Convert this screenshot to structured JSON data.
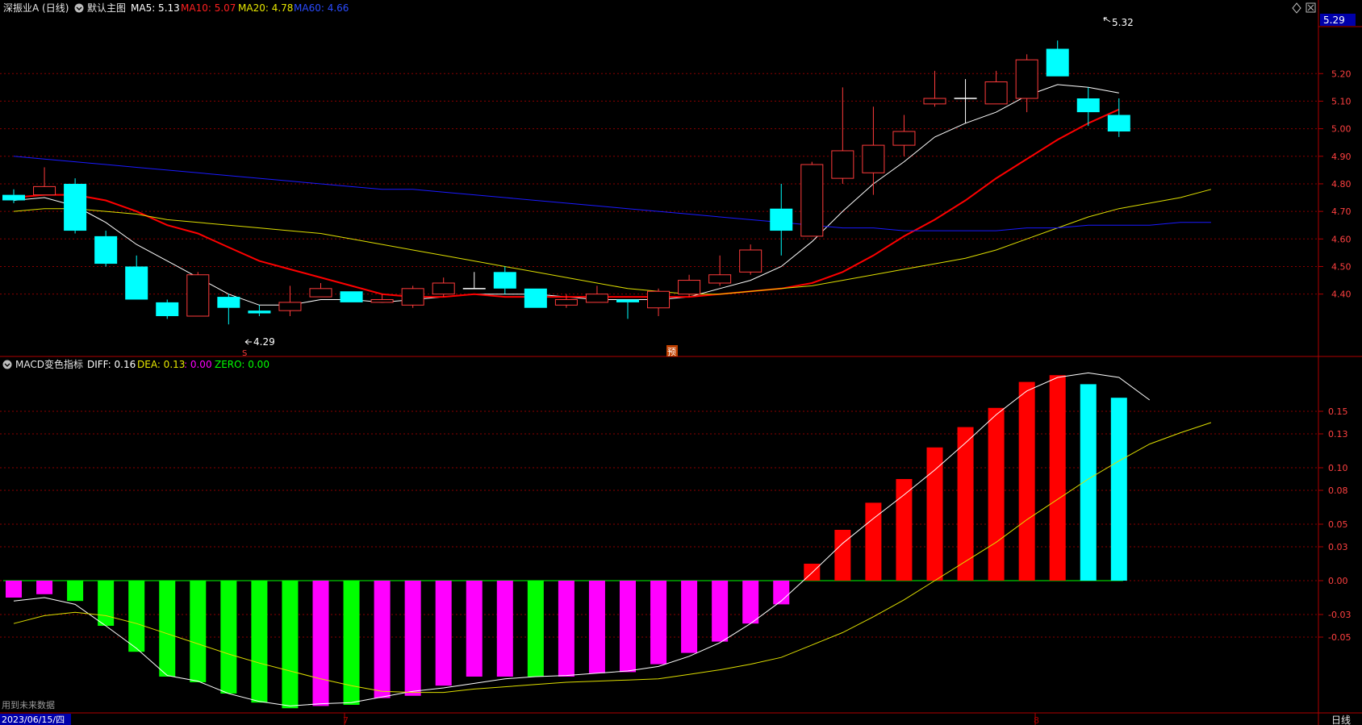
{
  "header": {
    "title": "深振业A (日线)",
    "main_label": "默认主图",
    "ma5_label": "MA5: 5.13",
    "ma10_label": "MA10: 5.07",
    "ma20_label": "MA20: 4.78",
    "ma60_label": "MA60: 4.66"
  },
  "macd_header": {
    "title": "MACD变色指标",
    "diff_label": "DIFF: 0.16",
    "dea_label": "DEA: 0.13",
    "macd_label": ": 0.00",
    "zero_label": "ZERO: 0.00"
  },
  "current_price": "5.29",
  "status_text": "用到未来数据",
  "bottom_bar": {
    "date_label": "2023/06/15/四",
    "period_label": "日线",
    "month_ticks": [
      "7",
      "8"
    ]
  },
  "markers": {
    "low": "4.29",
    "high": "5.32",
    "ex_right": "S",
    "forecast": "预"
  },
  "colors": {
    "up": "#ff3b3b",
    "down": "#00ffff",
    "ma5": "#ffffff",
    "ma10": "#ff0000",
    "ma20": "#dede00",
    "ma60": "#1a1aff",
    "grid": "#8b0000",
    "macd_pos": "#ff0000",
    "macd_pos_falling": "#00ffff",
    "macd_neg": "#ff00ff",
    "macd_neg_green": "#00ff00"
  },
  "chart_data": [
    {
      "type": "candlestick",
      "title": "深振业A (日线)",
      "ylim": [
        4.2,
        5.35
      ],
      "y_ticks": [
        4.4,
        4.5,
        4.6,
        4.7,
        4.8,
        4.9,
        5.0,
        5.1,
        5.2
      ],
      "candles": [
        {
          "o": 4.76,
          "h": 4.78,
          "l": 4.73,
          "c": 4.74
        },
        {
          "o": 4.76,
          "h": 4.86,
          "l": 4.76,
          "c": 4.79
        },
        {
          "o": 4.8,
          "h": 4.82,
          "l": 4.62,
          "c": 4.63
        },
        {
          "o": 4.61,
          "h": 4.63,
          "l": 4.5,
          "c": 4.51
        },
        {
          "o": 4.5,
          "h": 4.54,
          "l": 4.38,
          "c": 4.38
        },
        {
          "o": 4.37,
          "h": 4.38,
          "l": 4.31,
          "c": 4.32
        },
        {
          "o": 4.32,
          "h": 4.48,
          "l": 4.32,
          "c": 4.47
        },
        {
          "o": 4.39,
          "h": 4.4,
          "l": 4.29,
          "c": 4.35
        },
        {
          "o": 4.34,
          "h": 4.36,
          "l": 4.32,
          "c": 4.33
        },
        {
          "o": 4.34,
          "h": 4.43,
          "l": 4.32,
          "c": 4.37
        },
        {
          "o": 4.39,
          "h": 4.44,
          "l": 4.39,
          "c": 4.42
        },
        {
          "o": 4.41,
          "h": 4.41,
          "l": 4.37,
          "c": 4.37
        },
        {
          "o": 4.37,
          "h": 4.4,
          "l": 4.37,
          "c": 4.38
        },
        {
          "o": 4.36,
          "h": 4.43,
          "l": 4.35,
          "c": 4.42
        },
        {
          "o": 4.4,
          "h": 4.46,
          "l": 4.39,
          "c": 4.44
        },
        {
          "o": 4.42,
          "h": 4.48,
          "l": 4.42,
          "c": 4.42
        },
        {
          "o": 4.48,
          "h": 4.5,
          "l": 4.4,
          "c": 4.42
        },
        {
          "o": 4.42,
          "h": 4.42,
          "l": 4.35,
          "c": 4.35
        },
        {
          "o": 4.36,
          "h": 4.4,
          "l": 4.35,
          "c": 4.38
        },
        {
          "o": 4.37,
          "h": 4.43,
          "l": 4.37,
          "c": 4.4
        },
        {
          "o": 4.38,
          "h": 4.38,
          "l": 4.31,
          "c": 4.37
        },
        {
          "o": 4.35,
          "h": 4.42,
          "l": 4.32,
          "c": 4.41
        },
        {
          "o": 4.4,
          "h": 4.47,
          "l": 4.39,
          "c": 4.45
        },
        {
          "o": 4.44,
          "h": 4.54,
          "l": 4.43,
          "c": 4.47
        },
        {
          "o": 4.48,
          "h": 4.58,
          "l": 4.47,
          "c": 4.56
        },
        {
          "o": 4.71,
          "h": 4.8,
          "l": 4.54,
          "c": 4.63
        },
        {
          "o": 4.61,
          "h": 4.88,
          "l": 4.61,
          "c": 4.87
        },
        {
          "o": 4.82,
          "h": 5.15,
          "l": 4.8,
          "c": 4.92
        },
        {
          "o": 4.84,
          "h": 5.08,
          "l": 4.76,
          "c": 4.94
        },
        {
          "o": 4.94,
          "h": 5.05,
          "l": 4.9,
          "c": 4.99
        },
        {
          "o": 5.09,
          "h": 5.21,
          "l": 5.08,
          "c": 5.11
        },
        {
          "o": 5.11,
          "h": 5.18,
          "l": 5.02,
          "c": 5.11
        },
        {
          "o": 5.09,
          "h": 5.21,
          "l": 5.09,
          "c": 5.17
        },
        {
          "o": 5.11,
          "h": 5.27,
          "l": 5.06,
          "c": 5.25
        },
        {
          "o": 5.29,
          "h": 5.32,
          "l": 5.19,
          "c": 5.19
        },
        {
          "o": 5.11,
          "h": 5.15,
          "l": 5.01,
          "c": 5.06
        },
        {
          "o": 5.05,
          "h": 5.11,
          "l": 4.97,
          "c": 4.99
        }
      ],
      "series": [
        {
          "name": "MA5",
          "values": [
            4.74,
            4.75,
            4.72,
            4.66,
            4.58,
            4.52,
            4.46,
            4.4,
            4.36,
            4.36,
            4.38,
            4.38,
            4.37,
            4.38,
            4.39,
            4.4,
            4.4,
            4.4,
            4.39,
            4.38,
            4.38,
            4.38,
            4.39,
            4.42,
            4.45,
            4.5,
            4.59,
            4.7,
            4.8,
            4.88,
            4.97,
            5.02,
            5.06,
            5.12,
            5.16,
            5.15,
            5.13
          ]
        },
        {
          "name": "MA10",
          "values": [
            4.75,
            4.76,
            4.76,
            4.74,
            4.7,
            4.65,
            4.62,
            4.57,
            4.52,
            4.49,
            4.46,
            4.43,
            4.4,
            4.39,
            4.39,
            4.4,
            4.39,
            4.39,
            4.39,
            4.39,
            4.39,
            4.39,
            4.39,
            4.4,
            4.41,
            4.42,
            4.44,
            4.48,
            4.54,
            4.61,
            4.67,
            4.74,
            4.82,
            4.89,
            4.96,
            5.02,
            5.07
          ]
        },
        {
          "name": "MA20",
          "values": [
            4.7,
            4.71,
            4.71,
            4.7,
            4.69,
            4.67,
            4.66,
            4.65,
            4.64,
            4.63,
            4.62,
            4.6,
            4.58,
            4.56,
            4.54,
            4.52,
            4.5,
            4.48,
            4.46,
            4.44,
            4.42,
            4.41,
            4.4,
            4.4,
            4.41,
            4.42,
            4.43,
            4.45,
            4.47,
            4.49,
            4.51,
            4.53,
            4.56,
            4.6,
            4.64,
            4.68,
            4.71,
            4.73,
            4.75,
            4.78
          ]
        },
        {
          "name": "MA60",
          "values": [
            4.9,
            4.89,
            4.88,
            4.87,
            4.86,
            4.85,
            4.84,
            4.83,
            4.82,
            4.81,
            4.8,
            4.79,
            4.78,
            4.78,
            4.77,
            4.76,
            4.75,
            4.74,
            4.73,
            4.72,
            4.71,
            4.7,
            4.69,
            4.68,
            4.67,
            4.66,
            4.65,
            4.64,
            4.64,
            4.63,
            4.63,
            4.63,
            4.63,
            4.64,
            4.64,
            4.65,
            4.65,
            4.65,
            4.66,
            4.66
          ]
        }
      ]
    },
    {
      "type": "bar",
      "title": "MACD变色指标",
      "ylim": [
        -0.11,
        0.18
      ],
      "y_ticks": [
        -0.05,
        -0.03,
        0.0,
        0.03,
        0.05,
        0.08,
        0.1,
        0.13,
        0.15
      ],
      "values": [
        -0.015,
        -0.012,
        -0.018,
        -0.04,
        -0.063,
        -0.085,
        -0.09,
        -0.1,
        -0.108,
        -0.113,
        -0.111,
        -0.11,
        -0.104,
        -0.102,
        -0.093,
        -0.085,
        -0.085,
        -0.085,
        -0.085,
        -0.082,
        -0.081,
        -0.074,
        -0.064,
        -0.054,
        -0.038,
        -0.021,
        0.015,
        0.045,
        0.069,
        0.09,
        0.118,
        0.136,
        0.153,
        0.176,
        0.182,
        0.174,
        0.162
      ],
      "series": [
        {
          "name": "DIFF",
          "values": [
            -0.018,
            -0.015,
            -0.021,
            -0.04,
            -0.06,
            -0.084,
            -0.089,
            -0.1,
            -0.107,
            -0.111,
            -0.109,
            -0.108,
            -0.103,
            -0.098,
            -0.095,
            -0.091,
            -0.087,
            -0.085,
            -0.084,
            -0.082,
            -0.08,
            -0.076,
            -0.067,
            -0.055,
            -0.038,
            -0.018,
            0.007,
            0.033,
            0.055,
            0.076,
            0.098,
            0.122,
            0.147,
            0.168,
            0.18,
            0.184,
            0.18,
            0.16
          ]
        },
        {
          "name": "DEA",
          "values": [
            -0.038,
            -0.031,
            -0.028,
            -0.031,
            -0.038,
            -0.047,
            -0.056,
            -0.065,
            -0.073,
            -0.08,
            -0.087,
            -0.093,
            -0.098,
            -0.099,
            -0.099,
            -0.096,
            -0.094,
            -0.092,
            -0.09,
            -0.089,
            -0.088,
            -0.087,
            -0.083,
            -0.079,
            -0.074,
            -0.068,
            -0.057,
            -0.046,
            -0.032,
            -0.017,
            0.0,
            0.017,
            0.034,
            0.054,
            0.072,
            0.09,
            0.106,
            0.121,
            0.131,
            0.14
          ]
        }
      ]
    }
  ]
}
